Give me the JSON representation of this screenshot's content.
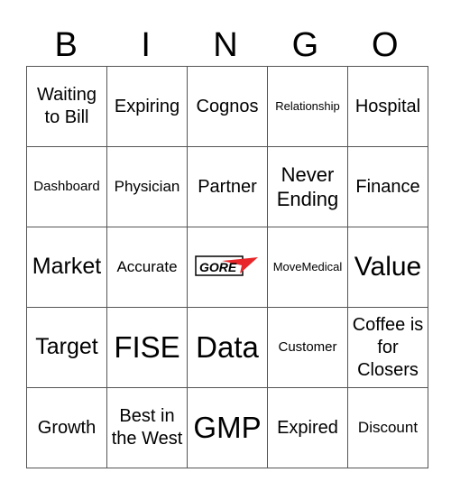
{
  "header": {
    "letters": [
      "B",
      "I",
      "N",
      "G",
      "O"
    ]
  },
  "grid": {
    "rows": [
      [
        "Waiting to Bill",
        "Expiring",
        "Cognos",
        "Relationship",
        "Hospital"
      ],
      [
        "Dashboard",
        "Physician",
        "Partner",
        "Never Ending",
        "Finance"
      ],
      [
        "Market",
        "Accurate",
        "",
        "MoveMedical",
        "Value"
      ],
      [
        "Target",
        "FISE",
        "Data",
        "Customer",
        "Coffee is for Closers"
      ],
      [
        "Growth",
        "Best in the West",
        "GMP",
        "Expired",
        "Discount"
      ]
    ],
    "free_space": {
      "logo_text": "GORE",
      "logo_icon": "gore-logo-icon",
      "accent_color": "#e8262a"
    }
  }
}
